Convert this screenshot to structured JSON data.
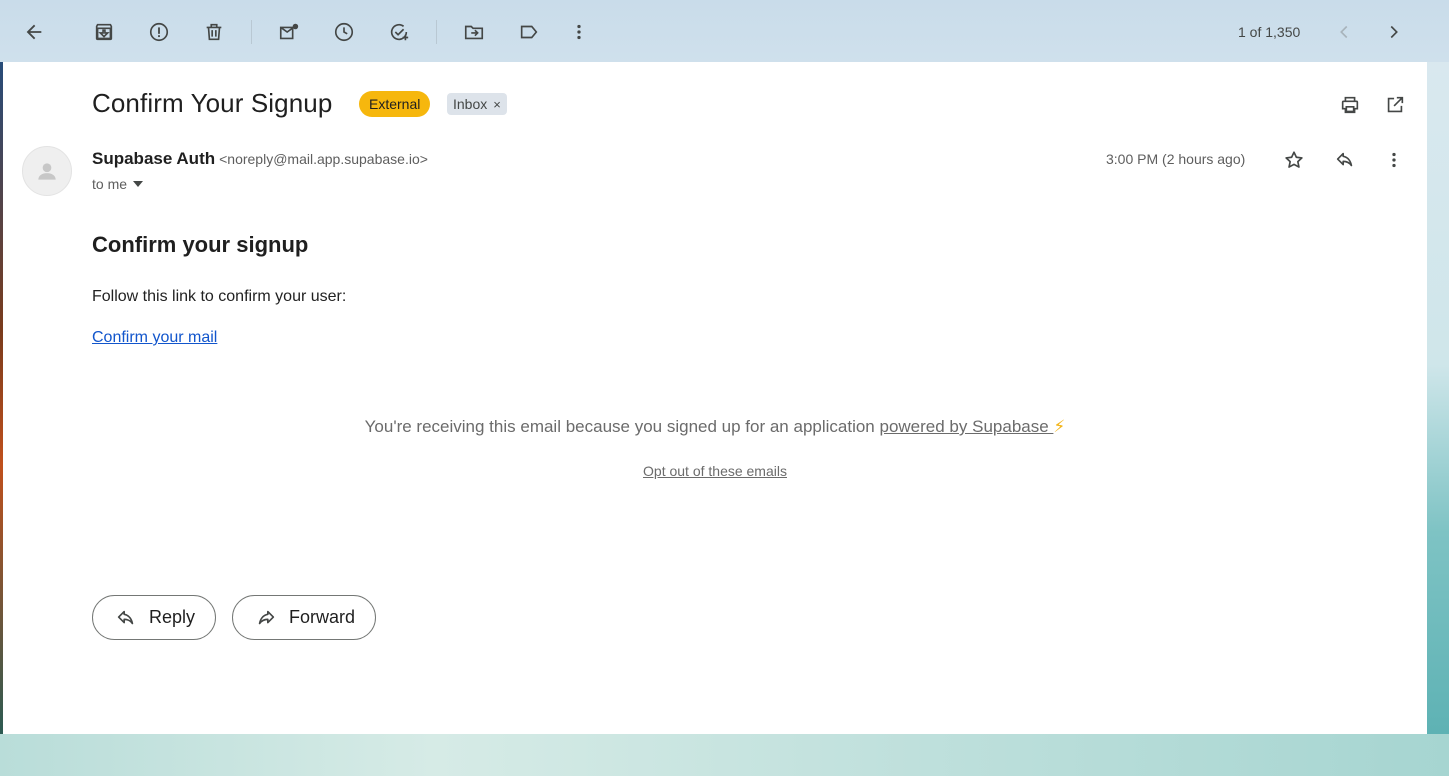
{
  "toolbar": {
    "pager_text": "1 of 1,350"
  },
  "email": {
    "subject": "Confirm Your Signup",
    "labels": {
      "external": "External",
      "inbox": "Inbox",
      "inbox_remove": "×"
    },
    "sender_name": "Supabase Auth",
    "sender_address": "<noreply@mail.app.supabase.io>",
    "recipient": "to me",
    "timestamp": "3:00 PM (2 hours ago)"
  },
  "body": {
    "heading": "Confirm your signup",
    "text": "Follow this link to confirm your user:",
    "link": "Confirm your mail",
    "footer_prefix": "You're receiving this email because you signed up for an application ",
    "footer_link": "powered by Supabase ",
    "footer_emoji": "⚡",
    "optout": "Opt out of these emails"
  },
  "actions": {
    "reply": "Reply",
    "forward": "Forward"
  },
  "colors": {
    "accent_link": "#1155cc",
    "external_badge": "#f6b70d",
    "inbox_badge": "#dde3ea"
  }
}
